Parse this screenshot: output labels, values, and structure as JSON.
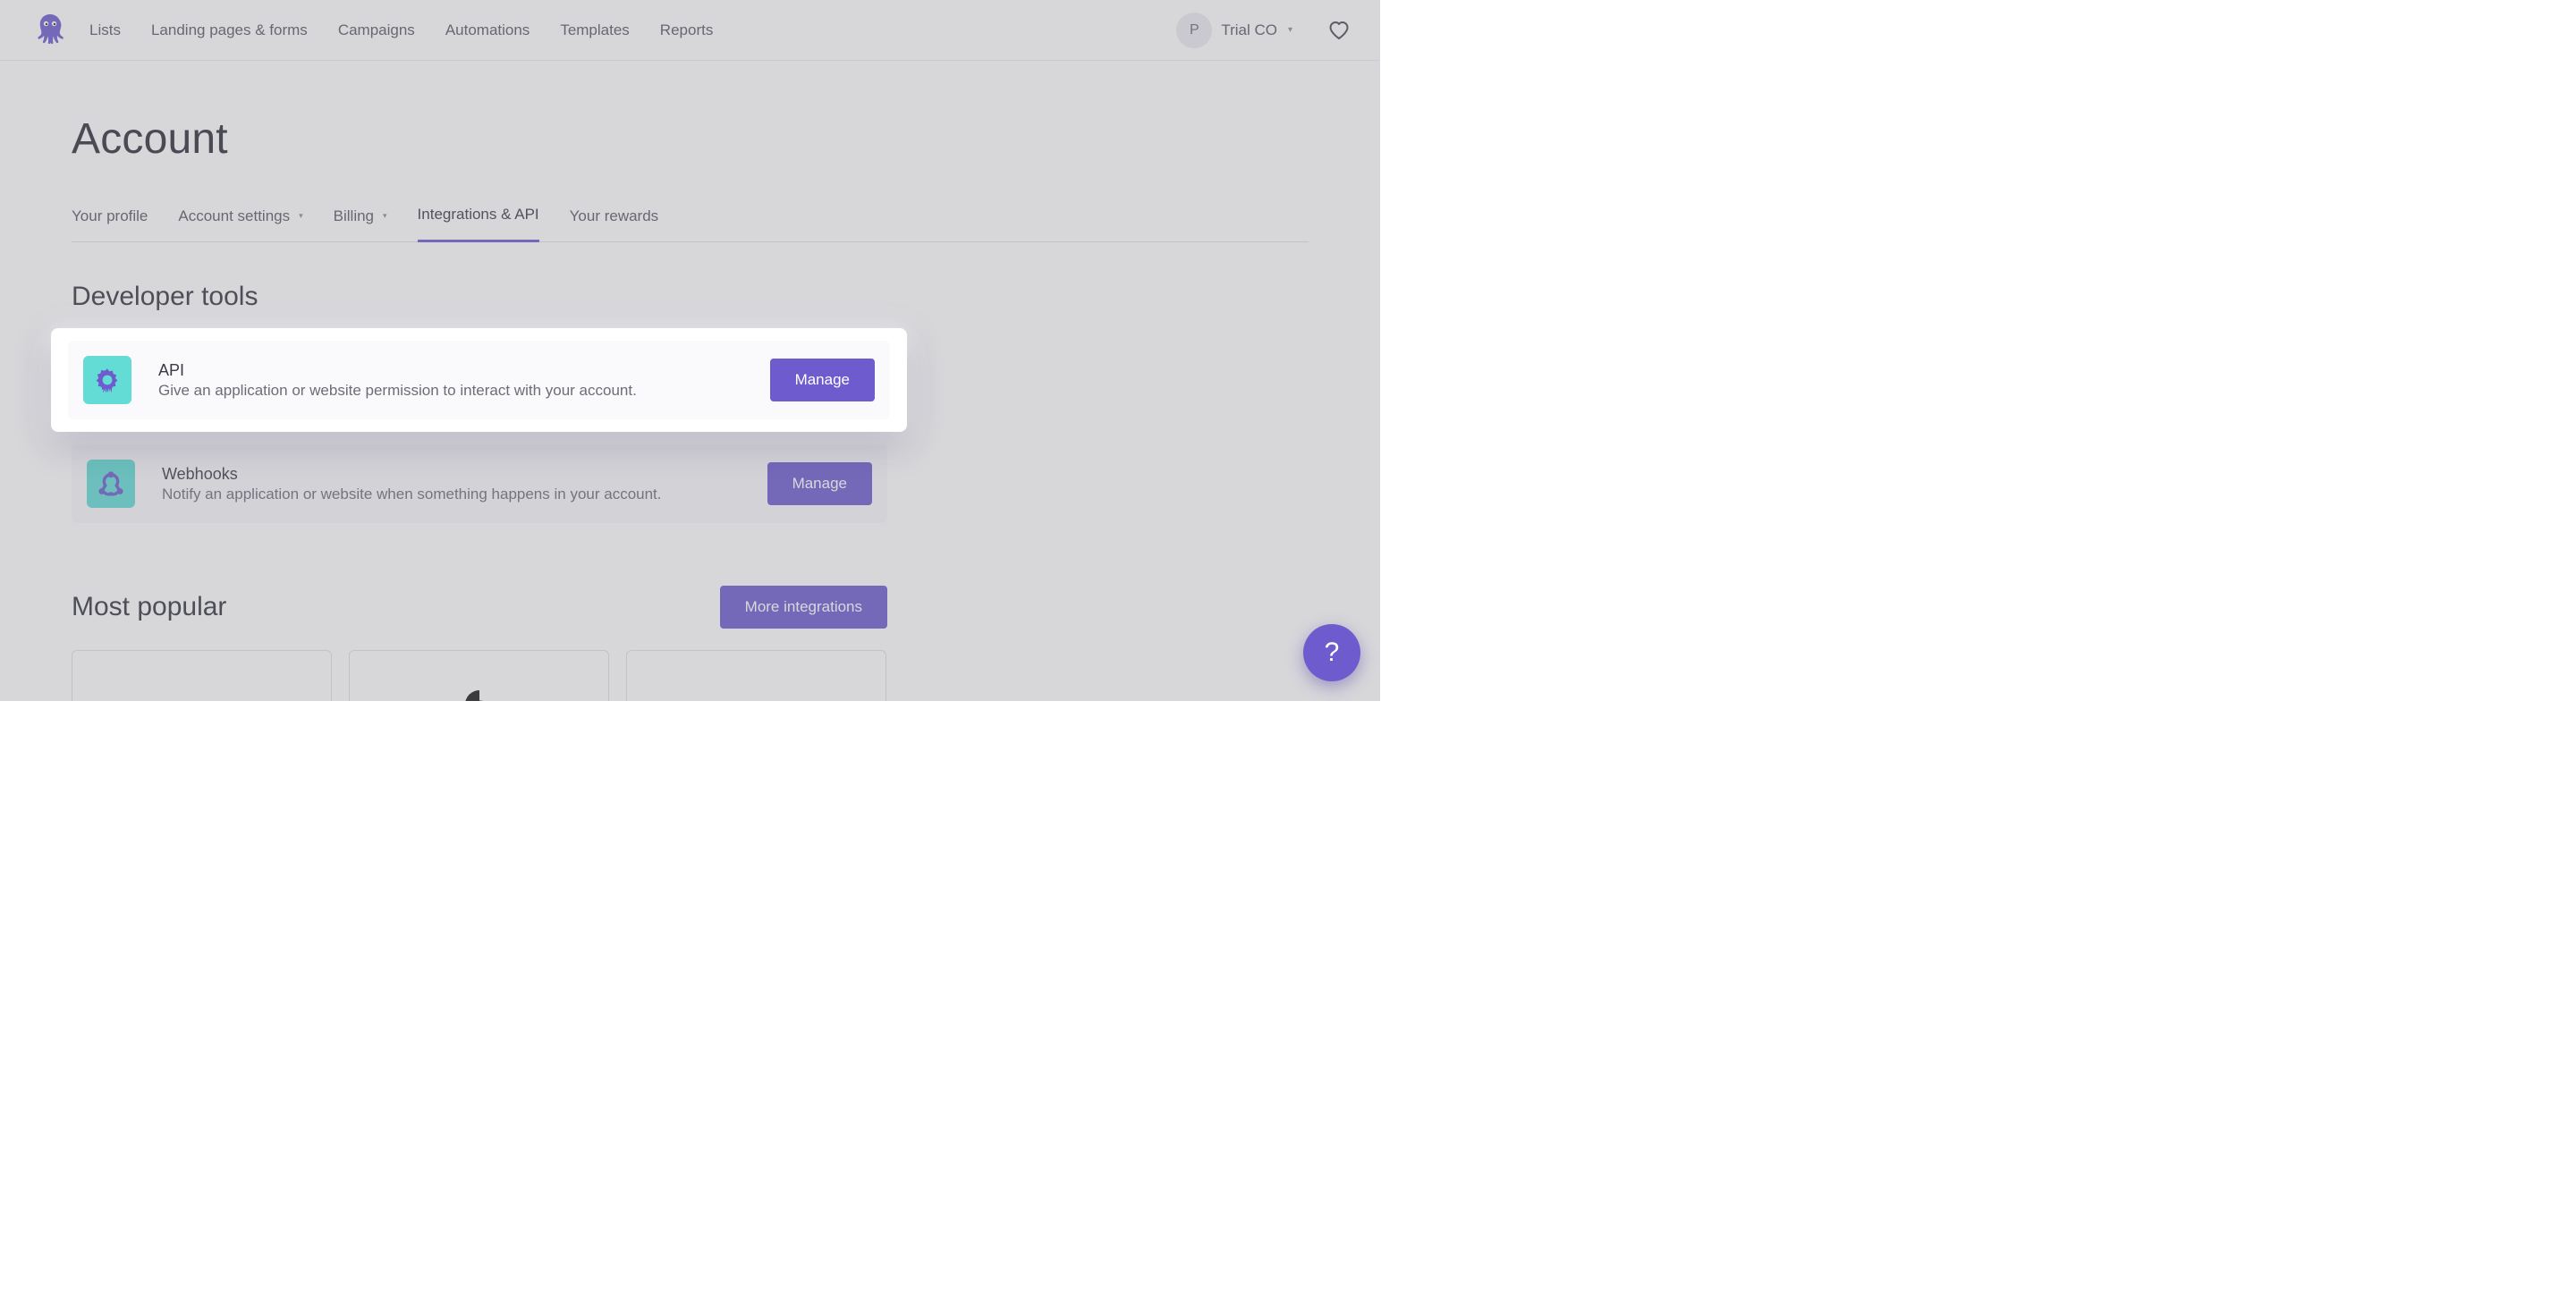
{
  "nav": {
    "items": [
      "Lists",
      "Landing pages & forms",
      "Campaigns",
      "Automations",
      "Templates",
      "Reports"
    ]
  },
  "user": {
    "initial": "P",
    "org": "Trial CO"
  },
  "page": {
    "title": "Account"
  },
  "tabs": [
    {
      "label": "Your profile",
      "dropdown": false,
      "active": false
    },
    {
      "label": "Account settings",
      "dropdown": true,
      "active": false
    },
    {
      "label": "Billing",
      "dropdown": true,
      "active": false
    },
    {
      "label": "Integrations & API",
      "dropdown": false,
      "active": true
    },
    {
      "label": "Your rewards",
      "dropdown": false,
      "active": false
    }
  ],
  "developer_tools": {
    "heading": "Developer tools",
    "items": [
      {
        "icon": "api",
        "name": "api-gear-icon",
        "title": "API",
        "description": "Give an application or website permission to interact with your account.",
        "action": "Manage"
      },
      {
        "icon": "webhooks",
        "name": "webhooks-icon",
        "title": "Webhooks",
        "description": "Notify an application or website when something happens in your account.",
        "action": "Manage"
      }
    ]
  },
  "most_popular": {
    "heading": "Most popular",
    "more_label": "More integrations",
    "items": [
      {
        "name": "integration-1"
      },
      {
        "name": "integration-2"
      },
      {
        "name": "integration-3"
      }
    ]
  },
  "help_fab": "?"
}
